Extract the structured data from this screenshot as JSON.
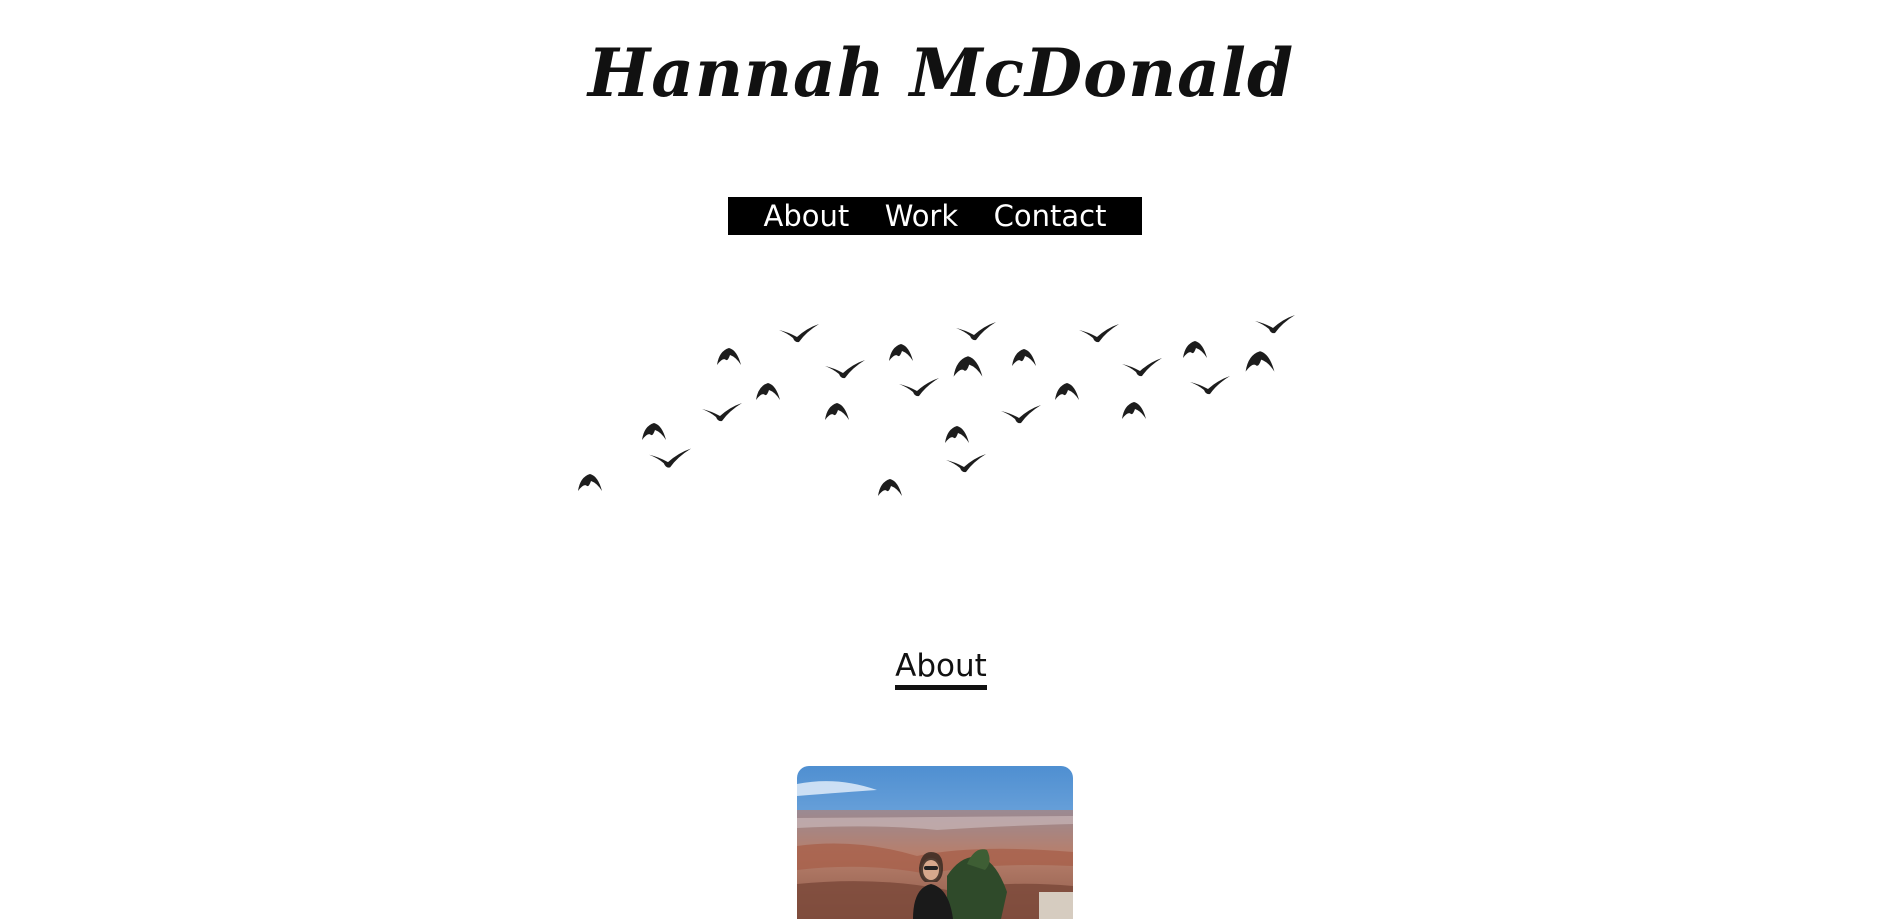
{
  "site": {
    "title": "Hannah McDonald"
  },
  "nav": {
    "items": [
      {
        "label": "About"
      },
      {
        "label": "Work"
      },
      {
        "label": "Contact"
      }
    ]
  },
  "hero": {
    "image": "flock-of-birds-silhouette"
  },
  "about": {
    "heading": "About",
    "photo": "portrait-at-grand-canyon"
  },
  "colors": {
    "text": "#111111",
    "nav_bg": "#000000",
    "nav_text": "#ffffff",
    "background": "#ffffff"
  }
}
